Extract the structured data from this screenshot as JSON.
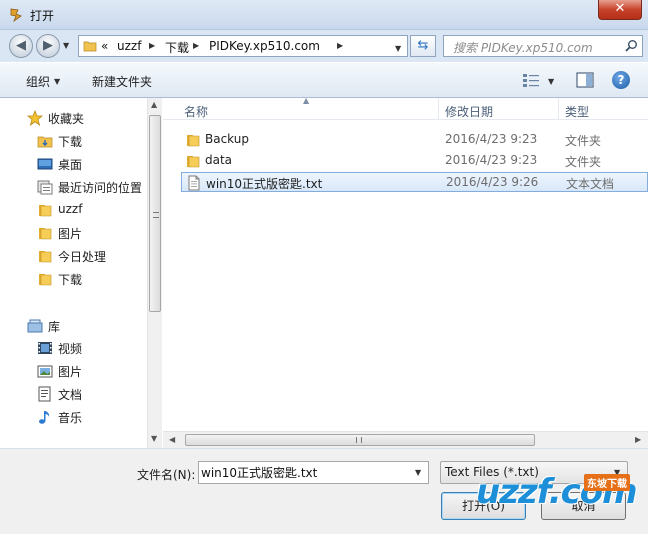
{
  "window": {
    "title": "打开",
    "close_glyph": "✕"
  },
  "address": {
    "overflow": "«",
    "crumbs": [
      "uzzf",
      "下载",
      "PIDKey.xp510.com"
    ]
  },
  "search": {
    "placeholder": "搜索 PIDKey.xp510.com"
  },
  "toolbar": {
    "organize": "组织",
    "new_folder": "新建文件夹",
    "help": "?"
  },
  "nav": {
    "favorites": {
      "header": "收藏夹",
      "items": [
        {
          "label": "下载",
          "icon": "download-folder"
        },
        {
          "label": "桌面",
          "icon": "desktop"
        },
        {
          "label": "最近访问的位置",
          "icon": "recent-places"
        },
        {
          "label": "uzzf",
          "icon": "folder"
        },
        {
          "label": "图片",
          "icon": "folder"
        },
        {
          "label": "今日处理",
          "icon": "folder"
        },
        {
          "label": "下载",
          "icon": "folder"
        }
      ]
    },
    "libraries": {
      "header": "库",
      "items": [
        {
          "label": "视频",
          "icon": "video-library"
        },
        {
          "label": "图片",
          "icon": "pictures-library"
        },
        {
          "label": "文档",
          "icon": "documents-library"
        },
        {
          "label": "音乐",
          "icon": "music-library"
        }
      ]
    }
  },
  "columns": {
    "name": "名称",
    "date": "修改日期",
    "type": "类型"
  },
  "files": [
    {
      "name": "Backup",
      "date": "2016/4/23 9:23",
      "type": "文件夹",
      "icon": "folder",
      "selected": false
    },
    {
      "name": "data",
      "date": "2016/4/23 9:23",
      "type": "文件夹",
      "icon": "folder",
      "selected": false
    },
    {
      "name": "win10正式版密匙.txt",
      "date": "2016/4/23 9:26",
      "type": "文本文档",
      "icon": "text-file",
      "selected": true
    }
  ],
  "bottom": {
    "filename_label": "文件名(N):",
    "filename_value": "win10正式版密匙.txt",
    "filetype_value": "Text Files (*.txt)",
    "open_button": "打开(O)",
    "cancel_button": "取消"
  },
  "watermark": {
    "logo": "uzzf.com",
    "badge": "东坡下载"
  },
  "colors": {
    "accent": "#1c8fd8",
    "selection": "#d8e8fa",
    "folder": "#f1c24f",
    "watermark_badge": "#e67017"
  }
}
